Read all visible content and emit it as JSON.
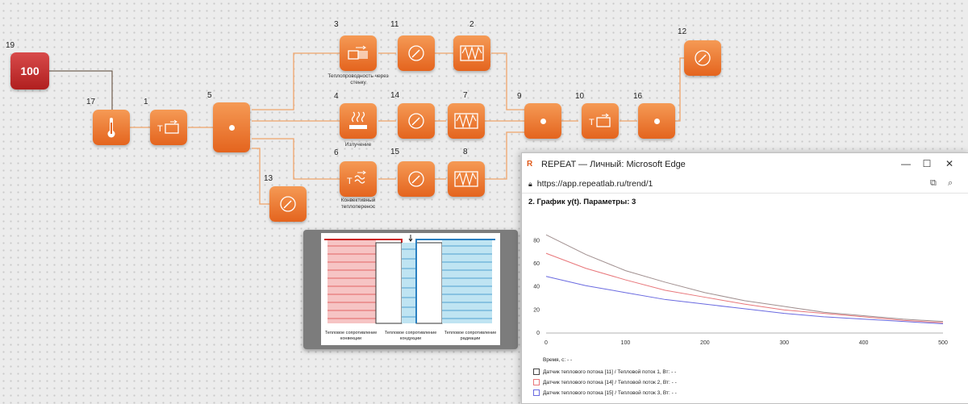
{
  "canvas": {
    "source_block": {
      "number": "19",
      "value": "100"
    },
    "blocks": [
      {
        "id": "b17",
        "number": "17",
        "icon": "thermometer-icon"
      },
      {
        "id": "b1",
        "number": "1",
        "icon": "temperature-source-icon"
      },
      {
        "id": "b5",
        "number": "5",
        "icon": "node-dot-icon"
      },
      {
        "id": "b3",
        "number": "3",
        "icon": "wall-conduction-icon",
        "caption": "Теплопроводность через стенку"
      },
      {
        "id": "b4",
        "number": "4",
        "icon": "radiation-icon",
        "caption": "Излучение"
      },
      {
        "id": "b6",
        "number": "6",
        "icon": "convection-icon",
        "caption": "Конвективный теплоперенос"
      },
      {
        "id": "b11",
        "number": "11",
        "icon": "heat-flux-sensor-icon"
      },
      {
        "id": "b14",
        "number": "14",
        "icon": "heat-flux-sensor-icon"
      },
      {
        "id": "b15",
        "number": "15",
        "icon": "heat-flux-sensor-icon"
      },
      {
        "id": "b13",
        "number": "13",
        "icon": "heat-flux-sensor-icon"
      },
      {
        "id": "b2",
        "number": "2",
        "icon": "heat-resistance-icon"
      },
      {
        "id": "b7",
        "number": "7",
        "icon": "heat-resistance-icon"
      },
      {
        "id": "b8",
        "number": "8",
        "icon": "heat-resistance-icon"
      },
      {
        "id": "b9",
        "number": "9",
        "icon": "node-dot-icon"
      },
      {
        "id": "b10",
        "number": "10",
        "icon": "temperature-source-icon"
      },
      {
        "id": "b16",
        "number": "16",
        "icon": "node-dot-icon"
      },
      {
        "id": "b12",
        "number": "12",
        "icon": "heat-flux-sensor-icon"
      }
    ]
  },
  "diagram": {
    "captions": [
      "Тепловое сопротивление конвекции",
      "Тепловое сопротивление кондукции",
      "Тепловое сопротивление радиации"
    ]
  },
  "browser": {
    "title": "REPEAT — Личный: Microsoft Edge",
    "url": "https://app.repeatlab.ru/trend/1",
    "chart_heading": "2. График y(t). Параметры: 3",
    "time_label": "Время, с: - -",
    "legend": [
      {
        "label": "Датчик теплового потока [11] / Тепловой поток 1, Вт: - -",
        "color": "#555555"
      },
      {
        "label": "Датчик теплового потока [14] / Тепловой поток 2, Вт: - -",
        "color": "#e8767a"
      },
      {
        "label": "Датчик теплового потока [15] / Тепловой поток 3, Вт: - -",
        "color": "#6a6ae0"
      }
    ]
  },
  "chart_data": {
    "type": "line",
    "title": "",
    "xlabel": "",
    "ylabel": "",
    "xlim": [
      0,
      500
    ],
    "ylim": [
      0,
      90
    ],
    "xticks": [
      0,
      100,
      200,
      300,
      400,
      500
    ],
    "yticks": [
      0,
      20,
      40,
      60,
      80
    ],
    "grid": false,
    "x": [
      0,
      50,
      100,
      150,
      200,
      250,
      300,
      350,
      400,
      450,
      500
    ],
    "series": [
      {
        "color": "#a08f8f",
        "values": [
          85,
          68,
          54,
          44,
          35,
          28,
          23,
          18,
          15,
          12,
          10
        ]
      },
      {
        "color": "#e8767a",
        "values": [
          69,
          56,
          46,
          37,
          31,
          25,
          20,
          17,
          14,
          11,
          9
        ]
      },
      {
        "color": "#6a6ae0",
        "values": [
          49,
          41,
          35,
          29,
          25,
          21,
          17,
          14,
          12,
          10,
          8
        ]
      }
    ]
  }
}
